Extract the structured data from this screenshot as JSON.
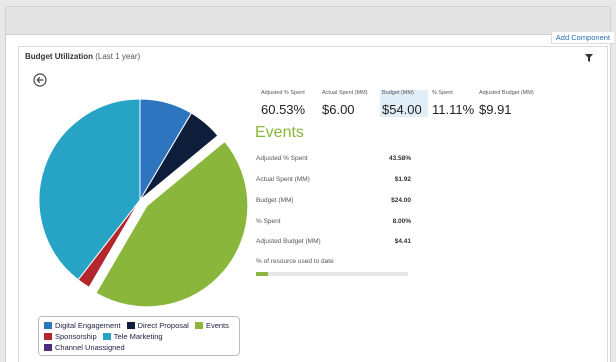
{
  "toolbar": {
    "add_component_label": "Add Component"
  },
  "card": {
    "title": "Budget Utilization",
    "subtitle": "(Last 1 year)",
    "icons": {
      "filter": "filter-icon",
      "back": "back-circle-icon"
    }
  },
  "summary": [
    {
      "label": "Adjusted % Spent",
      "value": "60.53%"
    },
    {
      "label": "Actual Spent (MM)",
      "value": "$6.00"
    },
    {
      "label": "Budget (MM)",
      "value": "$54.00"
    },
    {
      "label": "% Spent",
      "value": "11.11%"
    },
    {
      "label": "Adjusted Budget (MM)",
      "value": "$9.91"
    }
  ],
  "detail": {
    "title": "Events",
    "rows": [
      {
        "label": "Adjusted % Spent",
        "value": "43.58%"
      },
      {
        "label": "Actual Spent (MM)",
        "value": "$1.92"
      },
      {
        "label": "Budget (MM)",
        "value": "$24.00"
      },
      {
        "label": "% Spent",
        "value": "8.00%"
      },
      {
        "label": "Adjusted Budget (MM)",
        "value": "$4.41"
      }
    ],
    "progress_label": "% of resource used to date",
    "progress_fraction": 0.08
  },
  "chart_data": {
    "type": "pie",
    "title": "",
    "slices": [
      {
        "name": "Digital Engagement",
        "value": 8.5,
        "color": "#2e75c0",
        "exploded": false
      },
      {
        "name": "Direct Proposal",
        "value": 5.5,
        "color": "#0e1e3a",
        "exploded": false
      },
      {
        "name": "Events",
        "value": 44.4,
        "color": "#8ab63c",
        "exploded": true
      },
      {
        "name": "Sponsorship",
        "value": 2.1,
        "color": "#b3262b",
        "exploded": false
      },
      {
        "name": "Tele Marketing",
        "value": 39.5,
        "color": "#27a3c6",
        "exploded": false
      },
      {
        "name": "Channel Unassigned",
        "value": 0,
        "color": "#4b2e7a",
        "exploded": false
      }
    ],
    "legend_placement": "bottom"
  }
}
